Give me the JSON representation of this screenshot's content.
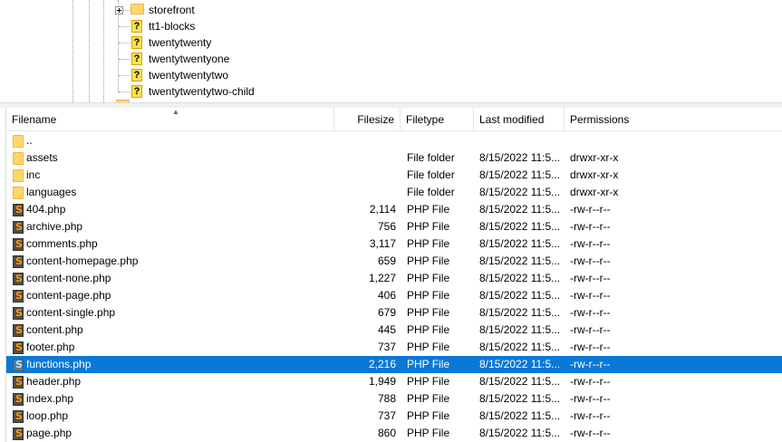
{
  "tree": {
    "items": [
      {
        "label": "storefront",
        "icon": "folder-icon",
        "expandable": true
      },
      {
        "label": "tt1-blocks",
        "icon": "unknown-icon",
        "expandable": false
      },
      {
        "label": "twentytwenty",
        "icon": "unknown-icon",
        "expandable": false
      },
      {
        "label": "twentytwentyone",
        "icon": "unknown-icon",
        "expandable": false
      },
      {
        "label": "twentytwentytwo",
        "icon": "unknown-icon",
        "expandable": false
      },
      {
        "label": "twentytwentytwo-child",
        "icon": "unknown-icon",
        "expandable": false
      }
    ]
  },
  "list": {
    "columns": {
      "filename": "Filename",
      "filesize": "Filesize",
      "filetype": "Filetype",
      "last_modified": "Last modified",
      "permissions": "Permissions"
    },
    "sort_indicator": "^",
    "selected_color": "#0a78d7",
    "rows": [
      {
        "name": "..",
        "size": "",
        "type": "",
        "modified": "",
        "perms": "",
        "icon": "folder-icon"
      },
      {
        "name": "assets",
        "size": "",
        "type": "File folder",
        "modified": "8/15/2022 11:5...",
        "perms": "drwxr-xr-x",
        "icon": "folder-icon"
      },
      {
        "name": "inc",
        "size": "",
        "type": "File folder",
        "modified": "8/15/2022 11:5...",
        "perms": "drwxr-xr-x",
        "icon": "folder-icon"
      },
      {
        "name": "languages",
        "size": "",
        "type": "File folder",
        "modified": "8/15/2022 11:5...",
        "perms": "drwxr-xr-x",
        "icon": "folder-icon"
      },
      {
        "name": "404.php",
        "size": "2,114",
        "type": "PHP File",
        "modified": "8/15/2022 11:5...",
        "perms": "-rw-r--r--",
        "icon": "php-file-icon"
      },
      {
        "name": "archive.php",
        "size": "756",
        "type": "PHP File",
        "modified": "8/15/2022 11:5...",
        "perms": "-rw-r--r--",
        "icon": "php-file-icon"
      },
      {
        "name": "comments.php",
        "size": "3,117",
        "type": "PHP File",
        "modified": "8/15/2022 11:5...",
        "perms": "-rw-r--r--",
        "icon": "php-file-icon"
      },
      {
        "name": "content-homepage.php",
        "size": "659",
        "type": "PHP File",
        "modified": "8/15/2022 11:5...",
        "perms": "-rw-r--r--",
        "icon": "php-file-icon"
      },
      {
        "name": "content-none.php",
        "size": "1,227",
        "type": "PHP File",
        "modified": "8/15/2022 11:5...",
        "perms": "-rw-r--r--",
        "icon": "php-file-icon"
      },
      {
        "name": "content-page.php",
        "size": "406",
        "type": "PHP File",
        "modified": "8/15/2022 11:5...",
        "perms": "-rw-r--r--",
        "icon": "php-file-icon"
      },
      {
        "name": "content-single.php",
        "size": "679",
        "type": "PHP File",
        "modified": "8/15/2022 11:5...",
        "perms": "-rw-r--r--",
        "icon": "php-file-icon"
      },
      {
        "name": "content.php",
        "size": "445",
        "type": "PHP File",
        "modified": "8/15/2022 11:5...",
        "perms": "-rw-r--r--",
        "icon": "php-file-icon"
      },
      {
        "name": "footer.php",
        "size": "737",
        "type": "PHP File",
        "modified": "8/15/2022 11:5...",
        "perms": "-rw-r--r--",
        "icon": "php-file-icon"
      },
      {
        "name": "functions.php",
        "size": "2,216",
        "type": "PHP File",
        "modified": "8/15/2022 11:5...",
        "perms": "-rw-r--r--",
        "icon": "php-file-icon",
        "selected": true
      },
      {
        "name": "header.php",
        "size": "1,949",
        "type": "PHP File",
        "modified": "8/15/2022 11:5...",
        "perms": "-rw-r--r--",
        "icon": "php-file-icon"
      },
      {
        "name": "index.php",
        "size": "788",
        "type": "PHP File",
        "modified": "8/15/2022 11:5...",
        "perms": "-rw-r--r--",
        "icon": "php-file-icon"
      },
      {
        "name": "loop.php",
        "size": "737",
        "type": "PHP File",
        "modified": "8/15/2022 11:5...",
        "perms": "-rw-r--r--",
        "icon": "php-file-icon"
      },
      {
        "name": "page.php",
        "size": "860",
        "type": "PHP File",
        "modified": "8/15/2022 11:5...",
        "perms": "-rw-r--r--",
        "icon": "php-file-icon"
      }
    ]
  }
}
